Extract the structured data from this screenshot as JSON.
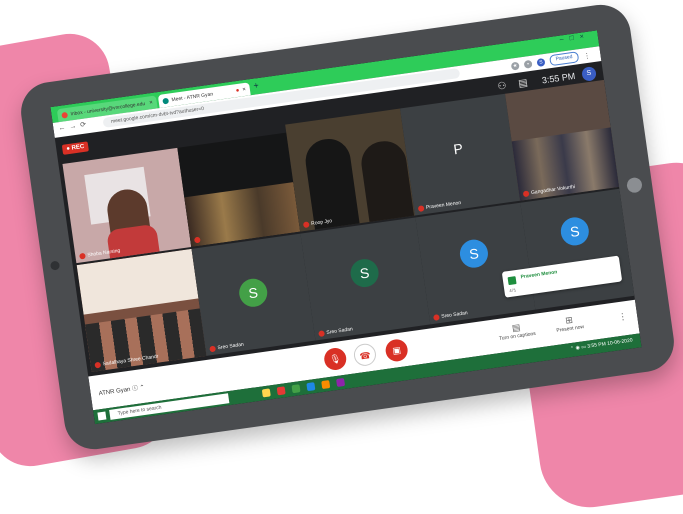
{
  "browser": {
    "tabs": [
      {
        "label": "Inbox - university@vnrcollege.edu",
        "active": false
      },
      {
        "label": "Meet - ATNR Gyan",
        "active": true
      }
    ],
    "url": "meet.google.com/cm-dvbt-tvd?authuser=0",
    "profile_status": "Paused",
    "profile_initial": "S"
  },
  "meet": {
    "rec_label": "REC",
    "clock": "3:55 PM",
    "participants": [
      {
        "name": "Shoba Narsing",
        "type": "video"
      },
      {
        "name": "",
        "type": "video"
      },
      {
        "name": "Roop Jyo",
        "type": "video"
      },
      {
        "name": "Praveen Menon",
        "type": "avatar",
        "initial": "P",
        "color": "#5b5fc7"
      },
      {
        "name": "Gangadhar Vokurthi",
        "type": "video"
      },
      {
        "name": "Sadalhaya Shree Chandr",
        "type": "video"
      },
      {
        "name": "Sreo Sadan",
        "type": "avatar",
        "initial": "S",
        "color": "#43a047"
      },
      {
        "name": "Sreo Sadan",
        "type": "avatar",
        "initial": "S",
        "color": "#1e6b4a"
      },
      {
        "name": "Sreo Sadan",
        "type": "avatar",
        "initial": "S",
        "color": "#2d8ee0"
      },
      {
        "name": "",
        "type": "avatar",
        "initial": "S",
        "color": "#2d8ee0"
      }
    ],
    "toast": {
      "name": "Praveen Menon",
      "sub": "471"
    },
    "meeting_title": "ATNR Gyan",
    "bottom_actions": {
      "captions": "Turn on captions",
      "present": "Present now"
    }
  },
  "taskbar": {
    "search_placeholder": "Type here to search",
    "tray_time": "3:55 PM",
    "tray_date": "10-06-2020"
  },
  "colors": {
    "accent_green": "#2ecc59",
    "background_pink": "#ef86a9",
    "meet_red": "#d93025",
    "device_frame": "#4a4c4f"
  }
}
